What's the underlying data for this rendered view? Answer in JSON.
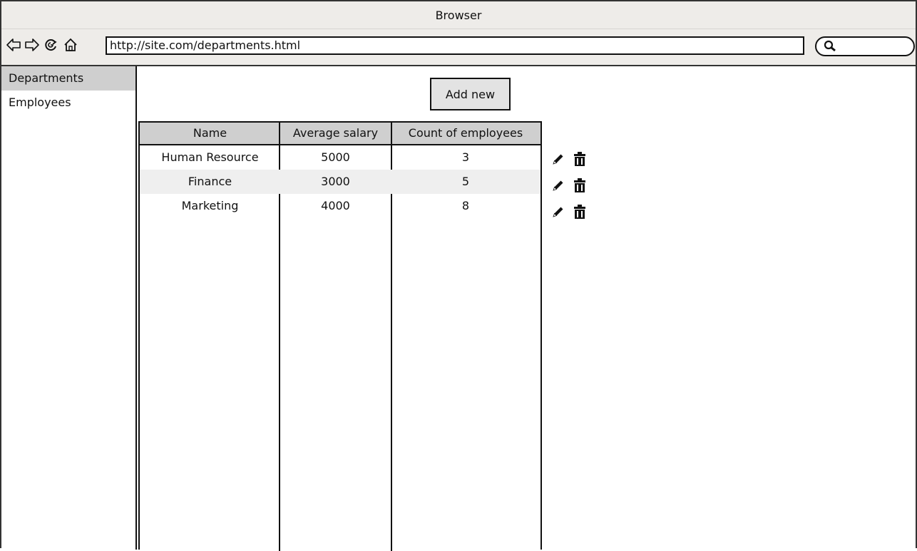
{
  "window": {
    "title": "Browser"
  },
  "toolbar": {
    "url": "http://site.com/departments.html",
    "search_value": "",
    "icons": [
      "back-arrow-icon",
      "forward-arrow-icon",
      "reload-icon",
      "home-icon",
      "search-icon"
    ]
  },
  "sidebar": {
    "items": [
      {
        "label": "Departments",
        "active": true
      },
      {
        "label": "Employees",
        "active": false
      }
    ]
  },
  "main": {
    "add_button_label": "Add new"
  },
  "table": {
    "columns": [
      "Name",
      "Average salary",
      "Count of employees"
    ],
    "rows": [
      {
        "name": "Human Resource",
        "salary": "5000",
        "count": "3"
      },
      {
        "name": "Finance",
        "salary": "3000",
        "count": "5"
      },
      {
        "name": "Marketing",
        "salary": "4000",
        "count": "8"
      }
    ],
    "row_actions": [
      "pencil-icon",
      "trash-icon"
    ]
  },
  "colors": {
    "chrome_bg": "#eeece9",
    "header_bg": "#cfcfcf",
    "active_item_bg": "#cfcfcf",
    "alt_row_bg": "#efefef",
    "border": "#111111"
  }
}
